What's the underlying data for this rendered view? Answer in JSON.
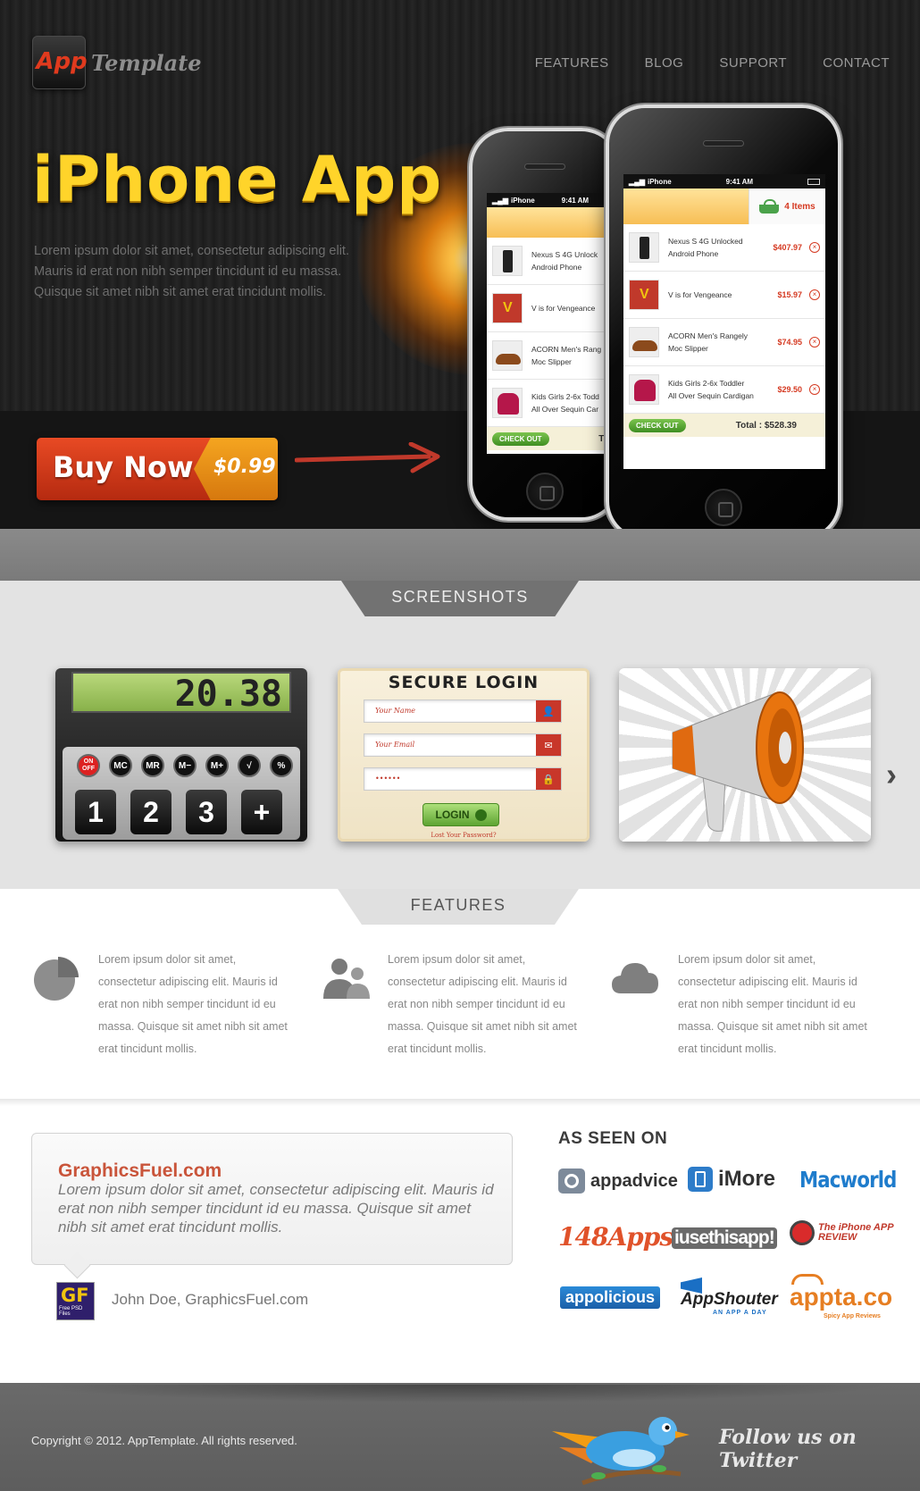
{
  "header": {
    "logo_app": "App",
    "logo_template": "Template",
    "nav": [
      "FEATURES",
      "BLOG",
      "SUPPORT",
      "CONTACT"
    ]
  },
  "hero": {
    "title": "iPhone App",
    "description": "Lorem ipsum dolor sit amet, consectetur adipiscing elit. Mauris id erat non nibh semper tincidunt id eu massa. Quisque sit amet nibh sit amet erat tincidunt mollis.",
    "buy_label": "Buy Now",
    "buy_price": "$0.99"
  },
  "phone": {
    "carrier": "iPhone",
    "time": "9:41 AM",
    "cart_count": "4 Items",
    "items": [
      {
        "name1": "Nexus S 4G Unlocked",
        "name2": "Android Phone",
        "price": "$407.97"
      },
      {
        "name1": "V is for Vengeance",
        "name2": "",
        "price": "$15.97"
      },
      {
        "name1": "ACORN Men's Rangely",
        "name2": "Moc Slipper",
        "price": "$74.95"
      },
      {
        "name1": "Kids Girls 2-6x Toddler",
        "name2": "All Over Sequin Cardigan",
        "price": "$29.50"
      }
    ],
    "checkout": "CHECK OUT",
    "total_label": "Total :",
    "total_value": "$528.39",
    "back_item_names": [
      "Nexus S 4G Unlock",
      "V is for Vengeance",
      "ACORN Men's Rang",
      "Kids Girls 2-6x Todd"
    ],
    "back_item_sub": [
      "Android Phone",
      "",
      "Moc Slipper",
      "All Over Sequin Car"
    ],
    "back_total": "Tot"
  },
  "screenshots": {
    "title": "SCREENSHOTS",
    "calc_display": "20.38",
    "calc_mkeys": [
      "ON OFF",
      "MC",
      "MR",
      "M−",
      "M+",
      "√",
      "%"
    ],
    "calc_nkeys": [
      "1",
      "2",
      "3",
      "+"
    ],
    "login_title": "SECURE LOGIN",
    "login_name_placeholder": "Your Name",
    "login_email_placeholder": "Your Email",
    "login_password_mask": "••••••",
    "login_button": "LOGIN",
    "login_lost": "Lost Your Password?"
  },
  "features": {
    "title": "FEATURES",
    "items": [
      "Lorem ipsum dolor sit amet, consectetur adipiscing elit. Mauris id erat non nibh semper tincidunt id eu massa. Quisque sit amet nibh sit amet erat tincidunt mollis.",
      "Lorem ipsum dolor sit amet, consectetur adipiscing elit. Mauris id erat non nibh semper tincidunt id eu massa. Quisque sit amet nibh sit amet erat tincidunt mollis.",
      "Lorem ipsum dolor sit amet, consectetur adipiscing elit. Mauris id erat non nibh semper tincidunt id eu massa. Quisque sit amet nibh sit amet erat tincidunt mollis."
    ]
  },
  "testimonial": {
    "site": "GraphicsFuel.com",
    "quote": "Lorem ipsum dolor sit amet, consectetur adipiscing elit. Mauris id erat non nibh semper tincidunt id eu massa. Quisque sit amet nibh sit amet erat tincidunt mollis.",
    "avatar_letters": "GF",
    "avatar_caption": "Free PSD Files",
    "author": "John Doe, GraphicsFuel.com"
  },
  "as_seen_on": {
    "title": "AS SEEN ON",
    "brands": [
      "appadvice",
      "iMore",
      "Macworld",
      "148Apps",
      "iusethisapp!",
      "The iPhone APP REVIEW",
      "appolicious",
      "AppShouter",
      "AN APP A DAY",
      "appta.co",
      "Spicy App Reviews"
    ]
  },
  "footer": {
    "copyright": "Copyright © 2012. AppTemplate. All rights reserved.",
    "follow": "Follow us on Twitter"
  }
}
